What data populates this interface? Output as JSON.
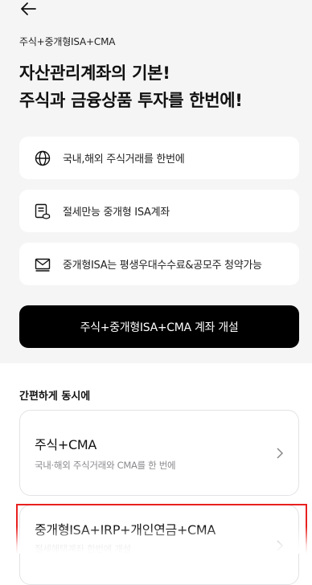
{
  "header": {
    "breadcrumb": "주식+중개형ISA+CMA",
    "headline_line1": "자산관리계좌의 기본!",
    "headline_line2": "주식과 금융상품 투자를 한번에!"
  },
  "features": [
    {
      "icon": "globe-icon",
      "label": "국내,해외 주식거래를 한번에"
    },
    {
      "icon": "document-coin-icon",
      "label": "절세만능 중개형 ISA계좌"
    },
    {
      "icon": "envelope-icon",
      "label": "중개형ISA는 평생우대수수료&공모주 청약가능"
    }
  ],
  "cta": {
    "label": "주식+중개형ISA+CMA 계좌 개설"
  },
  "section": {
    "title": "간편하게 동시에"
  },
  "cards": [
    {
      "title": "주식+CMA",
      "subtitle": "국내·해외 주식거래와 CMA를 한 번에"
    },
    {
      "title": "중개형ISA+IRP+개인연금+CMA",
      "subtitle": "절세혜택계좌 한번에 개설"
    }
  ],
  "colors": {
    "highlight": "#e8201f",
    "cta_bg": "#000000",
    "top_bg": "#f5f5f6"
  }
}
